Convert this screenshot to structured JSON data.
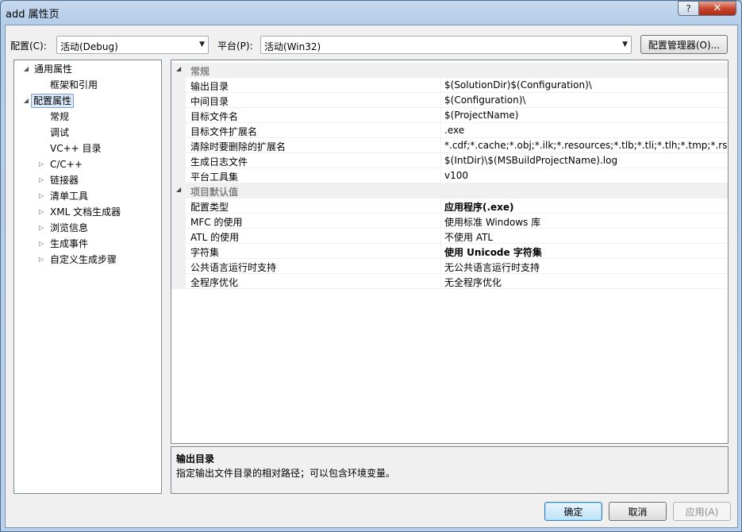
{
  "window": {
    "title": "add 属性页",
    "help_label": "?",
    "close_label": "✕"
  },
  "toolbar": {
    "config_label": "配置(C):",
    "config_value": "活动(Debug)",
    "platform_label": "平台(P):",
    "platform_value": "活动(Win32)",
    "config_manager_label": "配置管理器(O)..."
  },
  "tree": {
    "items": [
      {
        "label": "通用属性",
        "expander": "◢"
      },
      {
        "label": "框架和引用",
        "expander": ""
      },
      {
        "label": "配置属性",
        "expander": "◢"
      },
      {
        "label": "常规",
        "expander": ""
      },
      {
        "label": "调试",
        "expander": ""
      },
      {
        "label": "VC++ 目录",
        "expander": ""
      },
      {
        "label": "C/C++",
        "expander": "▷"
      },
      {
        "label": "链接器",
        "expander": "▷"
      },
      {
        "label": "清单工具",
        "expander": "▷"
      },
      {
        "label": "XML 文档生成器",
        "expander": "▷"
      },
      {
        "label": "浏览信息",
        "expander": "▷"
      },
      {
        "label": "生成事件",
        "expander": "▷"
      },
      {
        "label": "自定义生成步骤",
        "expander": "▷"
      }
    ]
  },
  "grid": {
    "categories": [
      {
        "label": "常规",
        "expander": "◢"
      },
      {
        "label": "项目默认值",
        "expander": "◢"
      }
    ],
    "general": [
      {
        "name": "输出目录",
        "value": "$(SolutionDir)$(Configuration)\\"
      },
      {
        "name": "中间目录",
        "value": "$(Configuration)\\"
      },
      {
        "name": "目标文件名",
        "value": "$(ProjectName)"
      },
      {
        "name": "目标文件扩展名",
        "value": ".exe"
      },
      {
        "name": "清除时要删除的扩展名",
        "value": "*.cdf;*.cache;*.obj;*.ilk;*.resources;*.tlb;*.tli;*.tlh;*.tmp;*.rsp;*.pgc"
      },
      {
        "name": "生成日志文件",
        "value": "$(IntDir)\\$(MSBuildProjectName).log"
      },
      {
        "name": "平台工具集",
        "value": "v100"
      }
    ],
    "defaults": [
      {
        "name": "配置类型",
        "value": "应用程序(.exe)"
      },
      {
        "name": "MFC 的使用",
        "value": "使用标准 Windows 库"
      },
      {
        "name": "ATL 的使用",
        "value": "不使用 ATL"
      },
      {
        "name": "字符集",
        "value": "使用 Unicode 字符集"
      },
      {
        "name": "公共语言运行时支持",
        "value": "无公共语言运行时支持"
      },
      {
        "name": "全程序优化",
        "value": "无全程序优化"
      }
    ]
  },
  "description": {
    "title": "输出目录",
    "text": "指定输出文件目录的相对路径；可以包含环境变量。"
  },
  "buttons": {
    "ok": "确定",
    "cancel": "取消",
    "apply": "应用(A)"
  }
}
